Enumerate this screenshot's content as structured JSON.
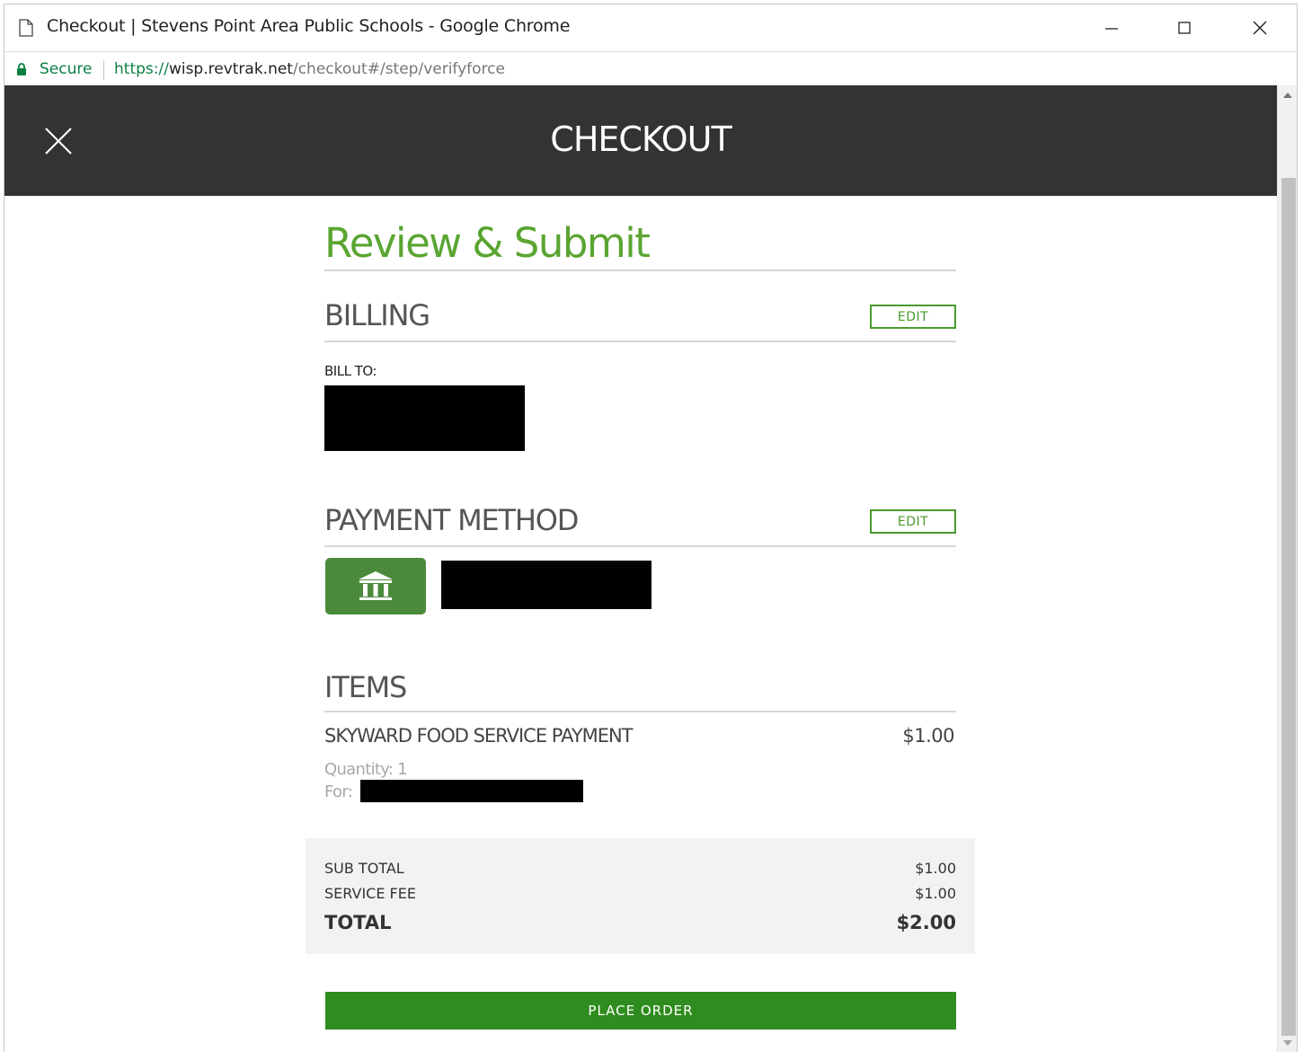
{
  "browser": {
    "window_title": "Checkout | Stevens Point Area Public Schools - Google Chrome",
    "secure_label": "Secure",
    "url_scheme": "https://",
    "url_host": "wisp.revtrak.net",
    "url_path": "/checkout#/step/verifyforce"
  },
  "header": {
    "title": "CHECKOUT"
  },
  "review": {
    "title": "Review & Submit"
  },
  "billing": {
    "title": "BILLING",
    "edit_label": "EDIT",
    "bill_to_label": "BILL TO:"
  },
  "payment": {
    "title": "PAYMENT METHOD",
    "edit_label": "EDIT",
    "icon": "bank-icon",
    "tile_color": "#4b8a3c"
  },
  "items": {
    "title": "ITEMS",
    "list": [
      {
        "name": "SKYWARD FOOD SERVICE PAYMENT",
        "price": "$1.00",
        "quantity_text": "Quantity: 1",
        "for_label": "For:"
      }
    ]
  },
  "totals": {
    "sub_total_label": "SUB TOTAL",
    "sub_total_value": "$1.00",
    "service_fee_label": "SERVICE FEE",
    "service_fee_value": "$1.00",
    "total_label": "TOTAL",
    "total_value": "$2.00"
  },
  "actions": {
    "place_order_label": "PLACE ORDER"
  },
  "colors": {
    "accent_green": "#5aa532",
    "button_green": "#2f8c1f",
    "header_bg": "#333333"
  }
}
